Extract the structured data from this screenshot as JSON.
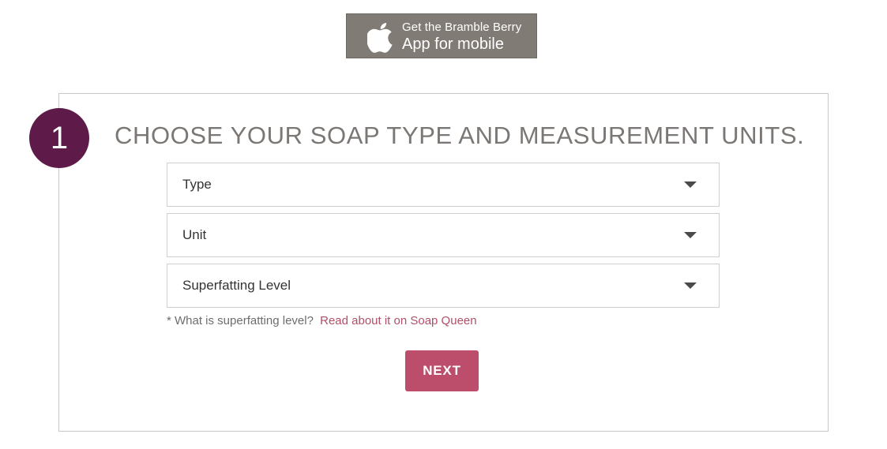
{
  "app_badge": {
    "line1": "Get the Bramble Berry",
    "line2": "App for mobile",
    "icon": "apple-icon",
    "background": "#807b74"
  },
  "step": {
    "number": "1",
    "title": "CHOOSE YOUR SOAP TYPE AND MEASUREMENT UNITS.",
    "circle_color": "#5e1a48"
  },
  "selects": {
    "type": {
      "label": "Type"
    },
    "unit": {
      "label": "Unit"
    },
    "superfat": {
      "label": "Superfatting Level"
    }
  },
  "note": {
    "text": "* What is superfatting level?",
    "link": "Read about it on Soap Queen",
    "link_color": "#b0506a"
  },
  "next_button": {
    "label": "NEXT",
    "color": "#bc4e6c"
  }
}
